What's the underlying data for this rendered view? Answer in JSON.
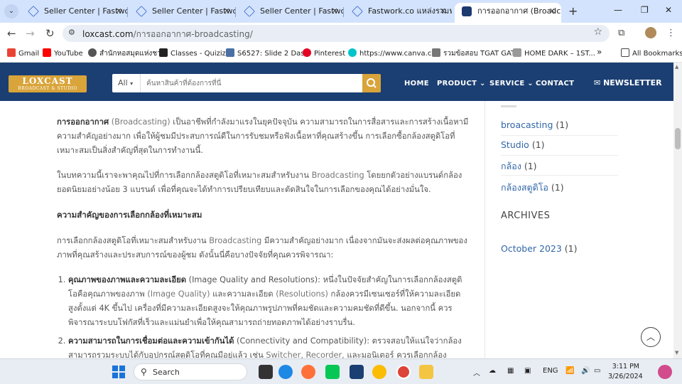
{
  "browser": {
    "tabs": [
      {
        "title": "Seller Center | Fastwork.c",
        "favicon": "fastwork-icon"
      },
      {
        "title": "Seller Center | Fastwork.c",
        "favicon": "fastwork-icon"
      },
      {
        "title": "Seller Center | Fastwork.c",
        "favicon": "fastwork-icon"
      },
      {
        "title": "Fastwork.co แหล่งรวมฟรีแลนซ์",
        "favicon": "fastwork-icon"
      },
      {
        "title": "การออกอากาศ (Broadcasting)",
        "favicon": "loxcast-icon"
      }
    ],
    "url_host": "loxcast.com",
    "url_path": "/การออกอากาศ-broadcasting/",
    "bookmarks": [
      {
        "label": "Gmail",
        "color": "#ea4335"
      },
      {
        "label": "YouTube",
        "color": "#ff0000"
      },
      {
        "label": "สำนักหอสมุดแห่งชาติ",
        "color": "#555555"
      },
      {
        "label": "Classes - Quizizz",
        "color": "#222222"
      },
      {
        "label": "S6527: Slide 2 Das...",
        "color": "#4a6fa5"
      },
      {
        "label": "Pinterest",
        "color": "#e60023"
      },
      {
        "label": "https://www.canva.c...",
        "color": "#00c4cc"
      },
      {
        "label": "รวมข้อสอบ TGAT GAT...",
        "color": "#777777"
      },
      {
        "label": "HOME DARK – 1ST...",
        "color": "#999999"
      }
    ],
    "more_bookmarks": "»",
    "all_bookmarks": "All Bookmarks"
  },
  "site": {
    "logo_main": "LOXCAST",
    "logo_sub": "BROADCAST & STUDIO",
    "search_category": "All",
    "search_placeholder": "ค้นหาสินค้าที่ต้องการที่นี่",
    "nav": [
      "HOME",
      "PRODUCT",
      "SERVICE",
      "CONTACT"
    ],
    "newsletter": "NEWSLETTER"
  },
  "article": {
    "p1_bold": "การออกอากาศ",
    "p1_kw": " (Broadcasting)",
    "p1_rest": " เป็นอาชีพที่กำลังมาแรงในยุคปัจจุบัน ความสามารถในการสื่อสารและการสร้างเนื้อหามีความสำคัญอย่างมาก เพื่อให้ผู้ชมมีประสบการณ์ดีในการรับชมหรือฟังเนื้อหาที่คุณสร้างขึ้น การเลือกซื้อกล้องสตูดิโอที่เหมาะสมเป็นสิ่งสำคัญที่สุดในการทำงานนี้.",
    "p2_a": "ในบทความนี้เราจะพาคุณไปที่การเลือกกล้องสตูดิโอที่เหมาะสมสำหรับงาน ",
    "p2_kw": "Broadcasting",
    "p2_b": " โดยยกตัวอย่างแบรนด์กล้องยอดนิยมอย่างน้อย 3 แบรนด์ เพื่อที่คุณจะได้ทำการเปรียบเทียบและตัดสินใจในการเลือกของคุณได้อย่างมั่นใจ.",
    "heading": "ความสำคัญของการเลือกกล้องที่เหมาะสม",
    "p3_a": "การเลือกกล้องสตูดิโอที่เหมาะสมสำหรับงาน ",
    "p3_kw": "Broadcasting",
    "p3_b": " มีความสำคัญอย่างมาก เนื่องจากมันจะส่งผลต่อคุณภาพของภาพที่คุณสร้างและประสบการณ์ของผู้ชม ดังนั้นนี่คือบางปัจจัยที่คุณควรพิจารณา:",
    "li1_bold": "คุณภาพของภาพและความละเอียด",
    "li1_a": " (Image Quality and Resolutions): หนึ่งในปัจจัยสำคัญในการเลือกกล้องสตูดิโอคือคุณภาพของภาพ ",
    "li1_kw1": "(Image Quality)",
    "li1_b": " และความละเอียด ",
    "li1_kw2": "(Resolutions)",
    "li1_c": " กล้องควรมีเซนเซอร์ที่ให้ความละเอียดสูงตั้งแต่ 4K ขึ้นไป เครื่องที่มีความละเอียดสูงจะให้คุณภาพรูปภาพที่คมชัดและความคมชัดที่ดีขึ้น. นอกจากนี้ ควรพิจารณาระบบโฟกัสที่เร็วและแม่นยำเพื่อให้คุณสามารถถ่ายทอดภาพได้อย่างราบรื่น.",
    "li2_bold": "ความสามารถในการเชื่อมต่อและความเข้ากันได้",
    "li2_a": " (Connectivity and Compatibility): ตรวจสอบให้แน่ใจว่ากล้องสามารถรวมระบบได้กับอุปกรณ์สตูดิโอที่คุณมีอยู่แล้ว เช่น ",
    "li2_kw": "Switcher, Recorder,",
    "li2_b": " และมอนิเตอร์ ควรเลือกกล้อง"
  },
  "sidebar": {
    "tags": [
      {
        "label": "broacasting",
        "count": "(1)"
      },
      {
        "label": "Studio",
        "count": "(1)"
      },
      {
        "label": "กล้อง",
        "count": "(1)"
      },
      {
        "label": "กล้องสตูดิโอ",
        "count": "(1)"
      }
    ],
    "archives_heading": "ARCHIVES",
    "archives": [
      {
        "label": "October 2023",
        "count": "(1)"
      }
    ]
  },
  "taskbar": {
    "search_label": "Search",
    "lang": "ENG",
    "time": "3:11 PM",
    "date": "3/26/2024"
  }
}
